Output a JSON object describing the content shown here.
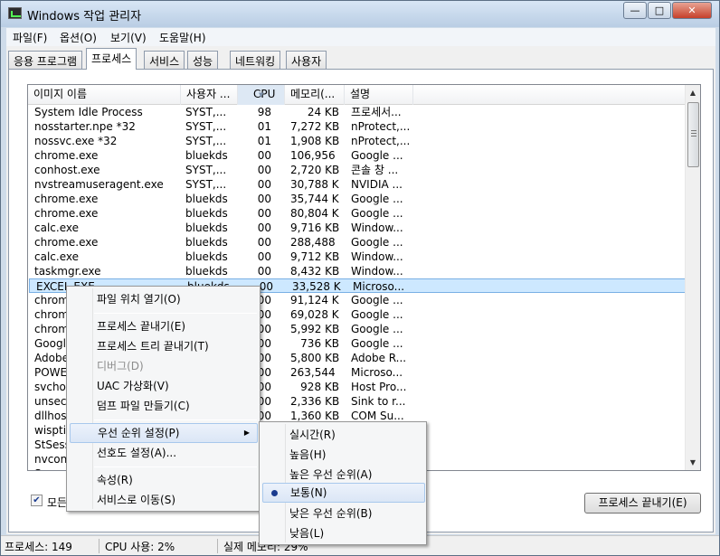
{
  "window": {
    "title": "Windows 작업 관리자",
    "minimize_glyph": "—",
    "maximize_glyph": "□",
    "close_glyph": "✕"
  },
  "menubar": [
    "파일(F)",
    "옵션(O)",
    "보기(V)",
    "도움말(H)"
  ],
  "tabs": [
    {
      "label": "응용 프로그램",
      "active": false
    },
    {
      "label": "프로세스",
      "active": true
    },
    {
      "label": "서비스",
      "active": false
    },
    {
      "label": "성능",
      "active": false
    },
    {
      "label": "네트워킹",
      "active": false
    },
    {
      "label": "사용자",
      "active": false
    }
  ],
  "columns": [
    "이미지 이름",
    "사용자 ...",
    "CPU",
    "메모리(...",
    "설명"
  ],
  "processes": [
    {
      "image": "System Idle Process",
      "user": "SYST,...",
      "cpu": "98",
      "mem": "24 KB",
      "desc": "프로세서..."
    },
    {
      "image": "nosstarter.npe *32",
      "user": "SYST,...",
      "cpu": "01",
      "mem": "7,272 KB",
      "desc": "nProtect,..."
    },
    {
      "image": "nossvc.exe *32",
      "user": "SYST,...",
      "cpu": "01",
      "mem": "1,908 KB",
      "desc": "nProtect,..."
    },
    {
      "image": "chrome.exe",
      "user": "bluekds",
      "cpu": "00",
      "mem": "106,956 ...",
      "desc": "Google ..."
    },
    {
      "image": "conhost.exe",
      "user": "SYST,...",
      "cpu": "00",
      "mem": "2,720 KB",
      "desc": "콘솔 창 ..."
    },
    {
      "image": "nvstreamuseragent.exe",
      "user": "SYST,...",
      "cpu": "00",
      "mem": "30,788 KB",
      "desc": "NVIDIA ..."
    },
    {
      "image": "chrome.exe",
      "user": "bluekds",
      "cpu": "00",
      "mem": "35,744 KB",
      "desc": "Google ..."
    },
    {
      "image": "chrome.exe",
      "user": "bluekds",
      "cpu": "00",
      "mem": "80,804 KB",
      "desc": "Google ..."
    },
    {
      "image": "calc.exe",
      "user": "bluekds",
      "cpu": "00",
      "mem": "9,716 KB",
      "desc": "Window..."
    },
    {
      "image": "chrome.exe",
      "user": "bluekds",
      "cpu": "00",
      "mem": "288,488 ...",
      "desc": "Google ..."
    },
    {
      "image": "calc.exe",
      "user": "bluekds",
      "cpu": "00",
      "mem": "9,712 KB",
      "desc": "Window..."
    },
    {
      "image": "taskmgr.exe",
      "user": "bluekds",
      "cpu": "00",
      "mem": "8,432 KB",
      "desc": "Window..."
    },
    {
      "image": "EXCEL.EXE",
      "user": "bluekds",
      "cpu": "00",
      "mem": "33,528 KB",
      "desc": "Microso...",
      "selected": true
    },
    {
      "image": "chrom",
      "user": "",
      "cpu": "00",
      "mem": "91,124 KB",
      "desc": "Google ..."
    },
    {
      "image": "chrom",
      "user": "",
      "cpu": "00",
      "mem": "69,028 KB",
      "desc": "Google ..."
    },
    {
      "image": "chrom",
      "user": "",
      "cpu": "00",
      "mem": "5,992 KB",
      "desc": "Google ..."
    },
    {
      "image": "Google",
      "user": "",
      "cpu": "00",
      "mem": "736 KB",
      "desc": "Google ..."
    },
    {
      "image": "Adobe",
      "user": "",
      "cpu": "00",
      "mem": "5,800 KB",
      "desc": "Adobe R..."
    },
    {
      "image": "POWE",
      "user": "",
      "cpu": "00",
      "mem": "263,544 ...",
      "desc": "Microso..."
    },
    {
      "image": "svchos",
      "user": "",
      "cpu": "00",
      "mem": "928 KB",
      "desc": "Host Pro..."
    },
    {
      "image": "unseca",
      "user": "",
      "cpu": "00",
      "mem": "2,336 KB",
      "desc": "Sink to r..."
    },
    {
      "image": "dllhost",
      "user": "",
      "cpu": "00",
      "mem": "1,360 KB",
      "desc": "COM Su..."
    },
    {
      "image": "wisptis",
      "user": "",
      "cpu": "",
      "mem": "",
      "desc": ""
    },
    {
      "image": "StSess",
      "user": "",
      "cpu": "",
      "mem": "",
      "desc": ""
    },
    {
      "image": "nvcont",
      "user": "",
      "cpu": "",
      "mem": "",
      "desc": ""
    },
    {
      "image": "Samsu",
      "user": "",
      "cpu": "",
      "mem": "",
      "desc": ""
    }
  ],
  "show_all_checkbox": {
    "label": "모든",
    "checked": true
  },
  "end_process_button": "프로세스 끝내기(E)",
  "status": {
    "processes": "프로세스: 149",
    "cpu": "CPU 사용: 2%",
    "memory": "실제 메모리: 29%"
  },
  "context_menu": {
    "items": [
      {
        "label": "파일 위치 열기(O)",
        "disabled": false
      },
      {
        "label": "프로세스 끝내기(E)",
        "disabled": false
      },
      {
        "label": "프로세스 트리 끝내기(T)",
        "disabled": false
      },
      {
        "label": "디버그(D)",
        "disabled": true
      },
      {
        "label": "UAC 가상화(V)",
        "disabled": false
      },
      {
        "label": "덤프 파일 만들기(C)",
        "disabled": false
      },
      {
        "label": "우선 순위 설정(P)",
        "disabled": false,
        "has_submenu": true
      },
      {
        "label": "선호도 설정(A)...",
        "disabled": false
      },
      {
        "label": "속성(R)",
        "disabled": false
      },
      {
        "label": "서비스로 이동(S)",
        "disabled": false
      }
    ]
  },
  "priority_submenu": {
    "items": [
      {
        "label": "실시간(R)",
        "selected": false
      },
      {
        "label": "높음(H)",
        "selected": false
      },
      {
        "label": "높은 우선 순위(A)",
        "selected": false
      },
      {
        "label": "보통(N)",
        "selected": true
      },
      {
        "label": "낮은 우선 순위(B)",
        "selected": false
      },
      {
        "label": "낮음(L)",
        "selected": false
      }
    ]
  }
}
